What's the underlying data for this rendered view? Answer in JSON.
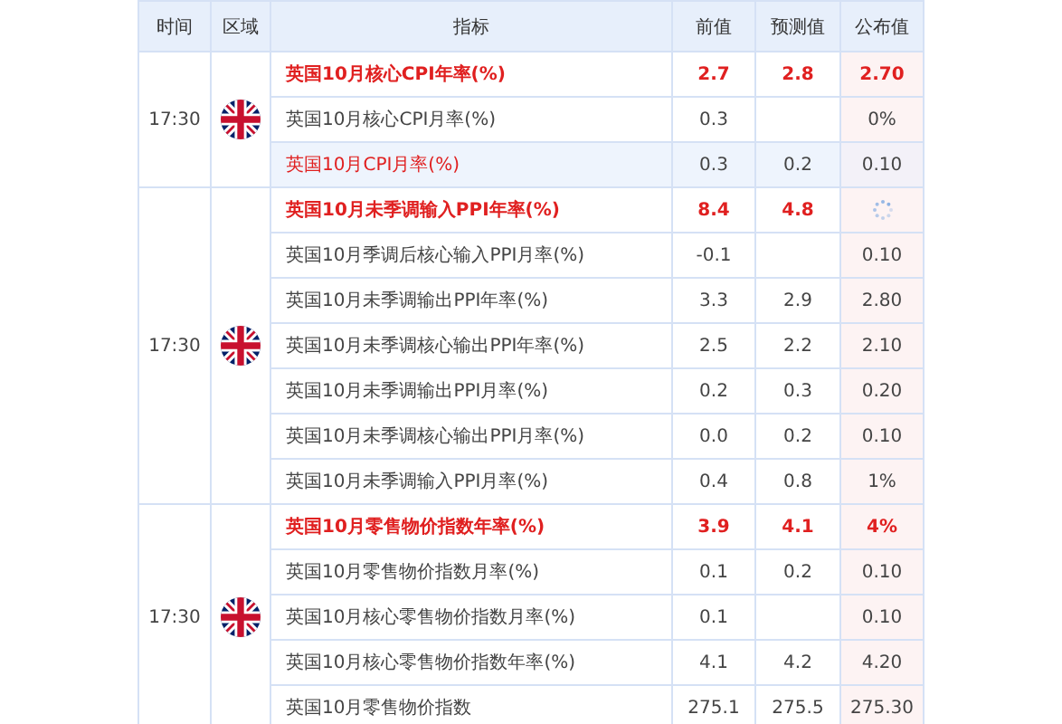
{
  "table": {
    "columns": [
      "时间",
      "区域",
      "指标",
      "前值",
      "预测值",
      "公布值"
    ],
    "groups": [
      {
        "time": "17:30",
        "rows": [
          {
            "indicator": "英国10月核心CPI年率(%)",
            "previous": "2.7",
            "forecast": "2.8",
            "actual": "2.70",
            "kind": "key",
            "highlighted": false,
            "pending": false
          },
          {
            "indicator": "英国10月核心CPI月率(%)",
            "previous": "0.3",
            "forecast": "",
            "actual": "0%",
            "kind": "normal",
            "highlighted": false,
            "pending": false
          },
          {
            "indicator": "英国10月CPI月率(%)",
            "previous": "0.3",
            "forecast": "0.2",
            "actual": "0.10",
            "kind": "red",
            "highlighted": true,
            "pending": false
          }
        ]
      },
      {
        "time": "17:30",
        "rows": [
          {
            "indicator": "英国10月未季调输入PPI年率(%)",
            "previous": "8.4",
            "forecast": "4.8",
            "actual": "",
            "kind": "key",
            "highlighted": false,
            "pending": true
          },
          {
            "indicator": "英国10月季调后核心输入PPI月率(%)",
            "previous": "-0.1",
            "forecast": "",
            "actual": "0.10",
            "kind": "normal",
            "highlighted": false,
            "pending": false
          },
          {
            "indicator": "英国10月未季调输出PPI年率(%)",
            "previous": "3.3",
            "forecast": "2.9",
            "actual": "2.80",
            "kind": "normal",
            "highlighted": false,
            "pending": false
          },
          {
            "indicator": "英国10月未季调核心输出PPI年率(%)",
            "previous": "2.5",
            "forecast": "2.2",
            "actual": "2.10",
            "kind": "normal",
            "highlighted": false,
            "pending": false
          },
          {
            "indicator": "英国10月未季调输出PPI月率(%)",
            "previous": "0.2",
            "forecast": "0.3",
            "actual": "0.20",
            "kind": "normal",
            "highlighted": false,
            "pending": false
          },
          {
            "indicator": "英国10月未季调核心输出PPI月率(%)",
            "previous": "0.0",
            "forecast": "0.2",
            "actual": "0.10",
            "kind": "normal",
            "highlighted": false,
            "pending": false
          },
          {
            "indicator": "英国10月未季调输入PPI月率(%)",
            "previous": "0.4",
            "forecast": "0.8",
            "actual": "1%",
            "kind": "normal",
            "highlighted": false,
            "pending": false
          }
        ]
      },
      {
        "time": "17:30",
        "rows": [
          {
            "indicator": "英国10月零售物价指数年率(%)",
            "previous": "3.9",
            "forecast": "4.1",
            "actual": "4%",
            "kind": "key",
            "highlighted": false,
            "pending": false
          },
          {
            "indicator": "英国10月零售物价指数月率(%)",
            "previous": "0.1",
            "forecast": "0.2",
            "actual": "0.10",
            "kind": "normal",
            "highlighted": false,
            "pending": false
          },
          {
            "indicator": "英国10月核心零售物价指数月率(%)",
            "previous": "0.1",
            "forecast": "",
            "actual": "0.10",
            "kind": "normal",
            "highlighted": false,
            "pending": false
          },
          {
            "indicator": "英国10月核心零售物价指数年率(%)",
            "previous": "4.1",
            "forecast": "4.2",
            "actual": "4.20",
            "kind": "normal",
            "highlighted": false,
            "pending": false
          },
          {
            "indicator": "英国10月零售物价指数",
            "previous": "275.1",
            "forecast": "275.5",
            "actual": "275.30",
            "kind": "normal",
            "highlighted": false,
            "pending": false
          }
        ]
      }
    ]
  }
}
